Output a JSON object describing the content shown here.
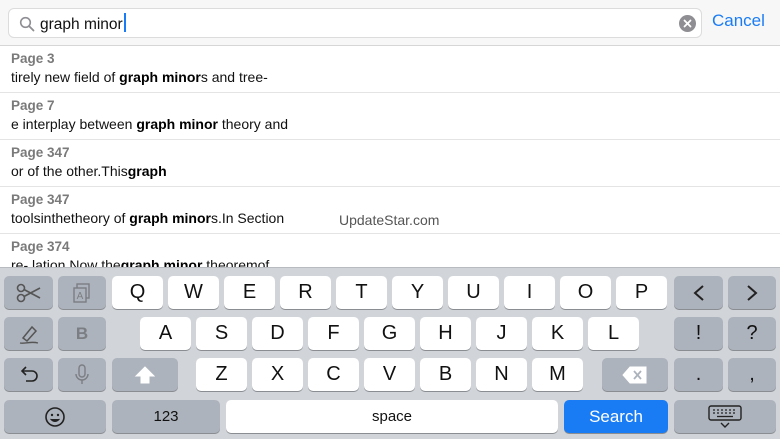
{
  "search": {
    "query": "graph minor",
    "cancel_label": "Cancel"
  },
  "results": [
    {
      "page": "Page 3",
      "pre": "tirely new field of ",
      "bold": "graph minor",
      "post": "s and tree-"
    },
    {
      "page": "Page 7",
      "pre": "e interplay between ",
      "bold": "graph minor",
      "post": " theory and"
    },
    {
      "page": "Page 347",
      "pre": "or of the other.This",
      "bold": "graph",
      "post": ""
    },
    {
      "page": "Page 347",
      "pre": "toolsinthetheory of ",
      "bold": "graph minor",
      "post": "s.In Section"
    },
    {
      "page": "Page 374",
      "pre": "re- lation.Now the",
      "bold": "graph minor",
      "post": " theoremof"
    }
  ],
  "watermark": "UpdateStar.com",
  "keyboard": {
    "row1": [
      "Q",
      "W",
      "E",
      "R",
      "T",
      "Y",
      "U",
      "I",
      "O",
      "P"
    ],
    "row2": [
      "A",
      "S",
      "D",
      "F",
      "G",
      "H",
      "J",
      "K",
      "L"
    ],
    "row3": [
      "Z",
      "X",
      "C",
      "V",
      "B",
      "N",
      "M"
    ],
    "bold_key": "B",
    "exclaim": "!",
    "question": "?",
    "period": ".",
    "comma": ",",
    "numbers_label": "123",
    "space_label": "space",
    "search_label": "Search",
    "icons": [
      "scissors-icon",
      "copy-icon",
      "left-arrow-icon",
      "right-arrow-icon",
      "highlight-icon",
      "undo-icon",
      "microphone-icon",
      "shift-icon",
      "backspace-icon",
      "emoji-icon",
      "keyboard-dismiss-icon"
    ]
  },
  "colors": {
    "accent": "#1a7cf5",
    "keyboard_bg": "#d1d4d9",
    "dark_key": "#adb3bc"
  }
}
